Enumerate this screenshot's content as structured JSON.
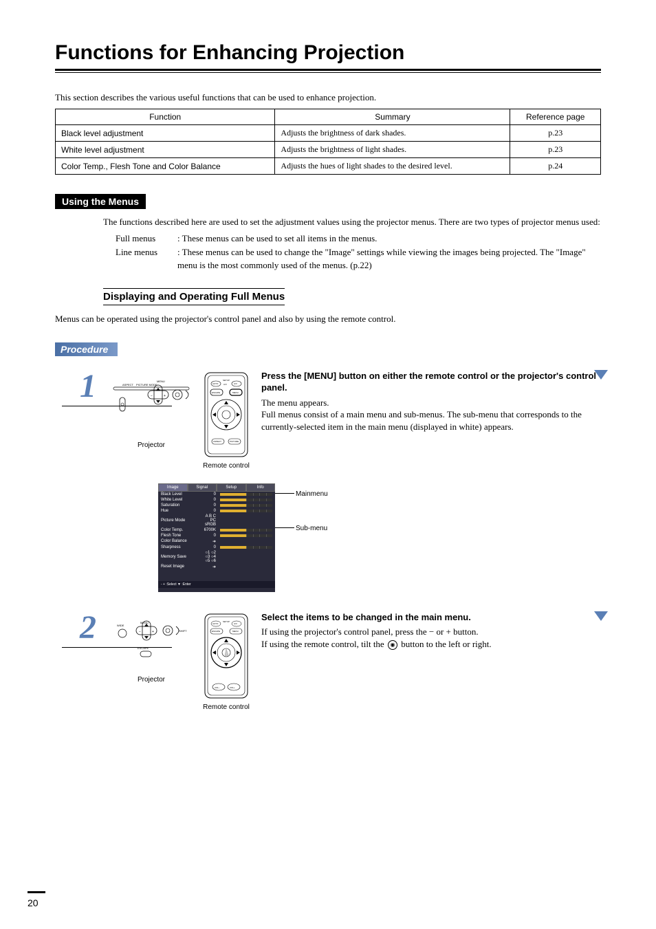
{
  "title": "Functions for Enhancing Projection",
  "intro": "This section describes the various useful functions that can be used to enhance projection.",
  "table": {
    "headers": {
      "fn": "Function",
      "sum": "Summary",
      "ref": "Reference page"
    },
    "rows": [
      {
        "fn": "Black level adjustment",
        "sum": "Adjusts the brightness of dark shades.",
        "ref": "p.23"
      },
      {
        "fn": "White level adjustment",
        "sum": "Adjusts the brightness of light shades.",
        "ref": "p.23"
      },
      {
        "fn": "Color Temp., Flesh Tone and Color Balance",
        "sum": "Adjusts the hues of light shades to the desired level.",
        "ref": "p.24"
      }
    ]
  },
  "section1": {
    "heading": "Using the Menus",
    "para": "The functions described here are used to set the adjustment values using the projector menus. There are two types of projector menus used:",
    "items": [
      {
        "label": "Full menus",
        "desc": ": These menus can be used to set all items in the menus."
      },
      {
        "label": "Line menus",
        "desc": ": These menus can be used to change the \"Image\" settings while viewing the images being projected. The \"Image\" menu is the most commonly used of the menus. (p.22)"
      }
    ]
  },
  "subsection": {
    "heading": "Displaying and Operating Full Menus",
    "intro": "Menus can be operated using the projector's control panel and also by using the remote control."
  },
  "procedure": "Procedure",
  "steps": {
    "s1": {
      "num": "1",
      "projector_label": "Projector",
      "remote_label": "Remote control",
      "head": "Press the [MENU] button on either the remote control or the projector's control panel.",
      "desc": "The menu appears.\nFull menus consist of a main menu and sub-menus. The sub-menu that corresponds to the currently-selected item in the main menu (displayed in white) appears."
    },
    "s2": {
      "num": "2",
      "projector_label": "Projector",
      "remote_label": "Remote control",
      "head": "Select the items to be changed in the main menu.",
      "desc_a": "If using the projector's control panel, press the ",
      "desc_b": " or ",
      "desc_c": " button.",
      "desc_d": "If using the remote control, tilt the ",
      "desc_e": " button to the left or right."
    }
  },
  "menu_diagram": {
    "main_label": "Mainmenu",
    "sub_label": "Sub-menu",
    "tabs": [
      "Image",
      "Signal",
      "Setup",
      "Info"
    ],
    "rows": [
      {
        "k": "Black Level",
        "v": "0"
      },
      {
        "k": "White Level",
        "v": "0"
      },
      {
        "k": "Saturation",
        "v": "0"
      },
      {
        "k": "Hue",
        "v": "0"
      },
      {
        "k": "Picture Mode",
        "v": "A  B  C  PC sRGB",
        "noslider": true
      },
      {
        "k": "Color Temp.",
        "v": "6700K"
      },
      {
        "k": "Flesh Tone",
        "v": "0"
      },
      {
        "k": "Color Balance",
        "v": "➜",
        "noslider": true
      },
      {
        "k": "Sharpness",
        "v": "0"
      },
      {
        "k": "Memory Save",
        "v": "○1 ○2 ○3 ○4 ○5 ○6",
        "noslider": true
      },
      {
        "k": "Reset Image",
        "v": "➜",
        "noslider": true
      }
    ],
    "foot": "- + :Select  ▼ :Enter"
  },
  "page_number": "20"
}
